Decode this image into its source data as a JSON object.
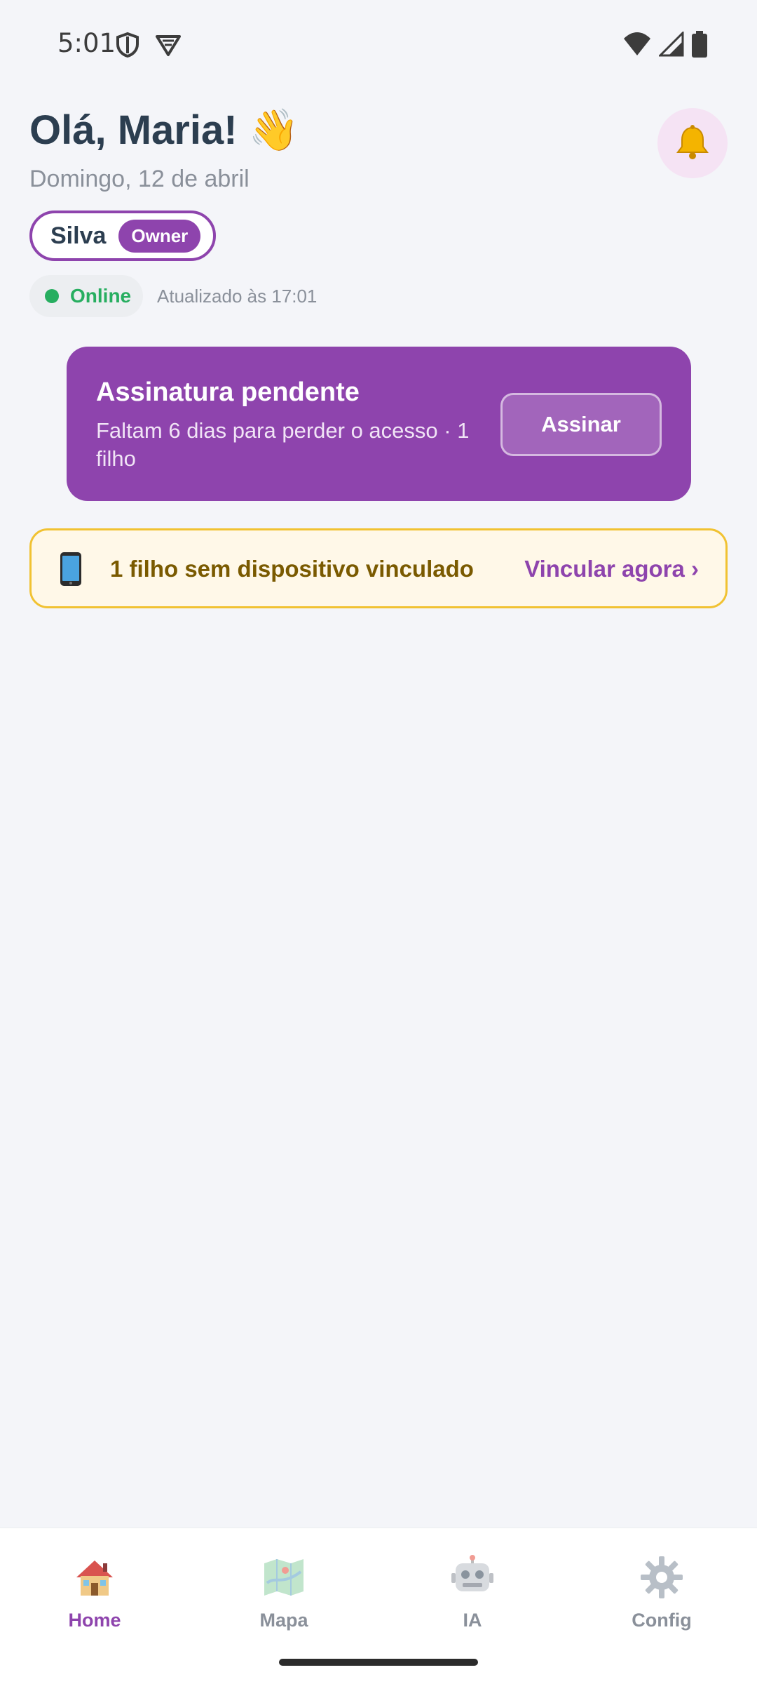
{
  "status_bar": {
    "time": "5:01",
    "left_icons": [
      "shield-icon",
      "vpn-icon"
    ],
    "right_icons": [
      "wifi-icon",
      "signal-icon",
      "battery-icon"
    ]
  },
  "header": {
    "greeting": "Olá, Maria! 👋",
    "date": "Domingo, 12 de abril",
    "notification_icon": "bell-icon"
  },
  "family": {
    "name": "Silva",
    "role": "Owner"
  },
  "connection": {
    "status": "Online",
    "updated": "Atualizado às 17:01"
  },
  "subscription": {
    "title": "Assinatura pendente",
    "description": "Faltam 6 dias para perder o acesso · 1 filho",
    "button": "Assinar"
  },
  "device_alert": {
    "icon": "phone-icon",
    "text": "1 filho sem dispositivo vinculado",
    "link": "Vincular agora ›"
  },
  "nav": {
    "items": [
      {
        "label": "Home",
        "icon": "home-icon",
        "active": true
      },
      {
        "label": "Mapa",
        "icon": "map-icon",
        "active": false
      },
      {
        "label": "IA",
        "icon": "robot-icon",
        "active": false
      },
      {
        "label": "Config",
        "icon": "gear-icon",
        "active": false
      }
    ]
  },
  "colors": {
    "accent": "#8e44ad",
    "online": "#27ae60",
    "warning_border": "#f1c232",
    "warning_bg": "#fff8e8",
    "background": "#f4f5f9"
  }
}
